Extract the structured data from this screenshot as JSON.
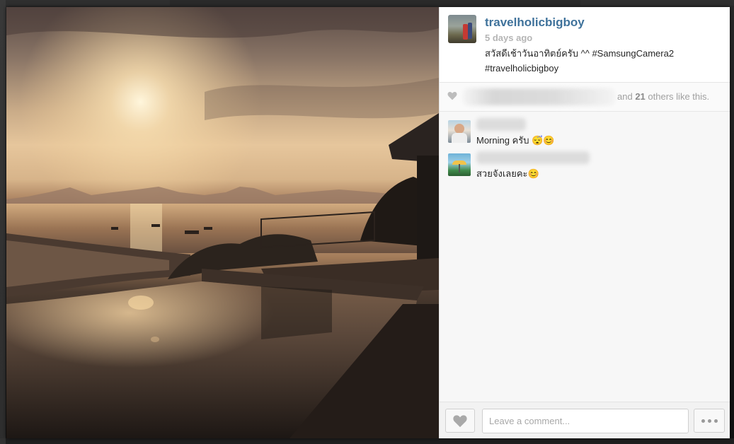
{
  "post": {
    "username": "travelholicbigboy",
    "time_ago": "5 days ago",
    "caption": "สวัสดีเช้าวันอาทิตย์ครับ ^^ #SamsungCamera2 #travelholicbigboy",
    "avatar_icon": "user-avatar",
    "photo_description": "sunset-over-bay-infinity-pool"
  },
  "likes": {
    "icon": "heart-icon",
    "and_text": "and",
    "others_count": "21",
    "others_suffix": "others like this."
  },
  "comments": [
    {
      "name_hidden": true,
      "text": "Morning ครับ 😴😊"
    },
    {
      "name_hidden": true,
      "text": "สวยจังเลยคะ😊"
    }
  ],
  "footer": {
    "comment_placeholder": "Leave a comment...",
    "like_icon": "heart-icon",
    "more_icon": "ellipsis-icon"
  },
  "colors": {
    "username": "#3f729b",
    "muted": "#b5b5b5",
    "text": "#262626"
  }
}
